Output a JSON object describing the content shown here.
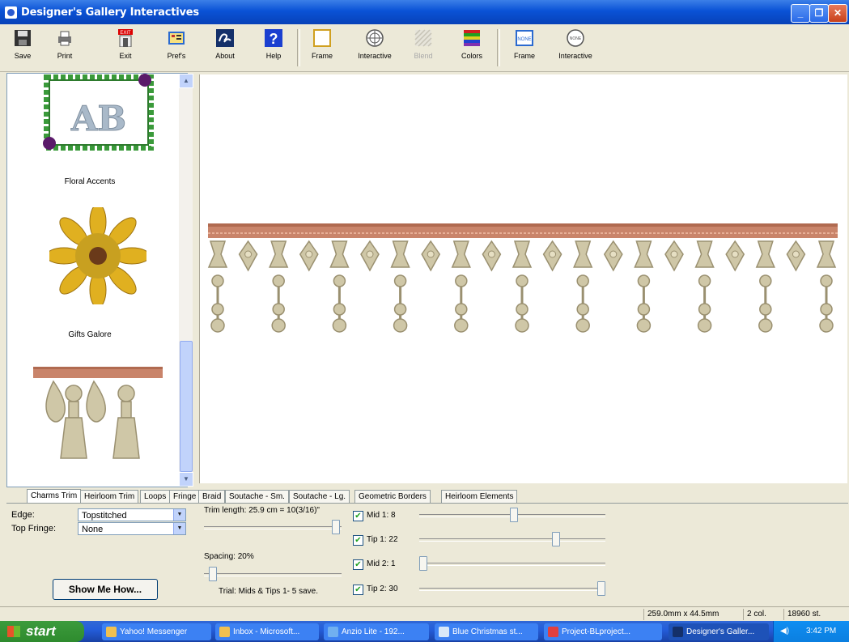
{
  "window": {
    "title": "Designer's Gallery Interactives"
  },
  "toolbar": {
    "save": "Save",
    "print": "Print",
    "exit": "Exit",
    "prefs": "Pref's",
    "about": "About",
    "help": "Help",
    "frame1": "Frame",
    "interactive1": "Interactive",
    "disabled": "Blend",
    "colors": "Colors",
    "frame2": "Frame",
    "interactive2": "Interactive",
    "exit_badge": "EXIT",
    "none_badge": "NONE"
  },
  "gallery": {
    "items": [
      {
        "caption": "Floral Accents",
        "monogram": "AB"
      },
      {
        "caption": "Gifts Galore"
      },
      {
        "caption": ""
      }
    ]
  },
  "tabs": [
    "Charms Trim",
    "Heirloom Trim",
    "Loops",
    "Fringe",
    "Braid",
    "Soutache - Sm.",
    "Soutache - Lg.",
    "Geometric Borders",
    "Heirloom Elements"
  ],
  "props": {
    "edge_label": "Edge:",
    "edge_value": "Topstitched",
    "topfringe_label": "Top Fringe:",
    "topfringe_value": "None",
    "trim_length": "Trim length: 25.9 cm = 10(3/16)\"",
    "spacing": "Spacing: 20%",
    "note": "Trial: Mids & Tips 1- 5 save.",
    "show_me_how": "Show Me How...",
    "mid1": "Mid 1: 8",
    "tip1": "Tip 1: 22",
    "mid2": "Mid 2: 1",
    "tip2": "Tip 2: 30"
  },
  "status": {
    "size": "259.0mm x 44.5mm",
    "cols": "2 col.",
    "stitches": "18960 st."
  },
  "taskbar": {
    "start": "start",
    "tasks": [
      "Yahoo! Messenger",
      "Inbox - Microsoft...",
      "Anzio Lite - 192...",
      "Blue Christmas st...",
      "Project-BLproject...",
      "Designer's Galler..."
    ],
    "clock": "3:42 PM"
  },
  "colors": {
    "trim_band": "#c9846a",
    "charm": "#cfc7a7",
    "charm_outline": "#9a9070",
    "sunflower": "#d4a017"
  }
}
